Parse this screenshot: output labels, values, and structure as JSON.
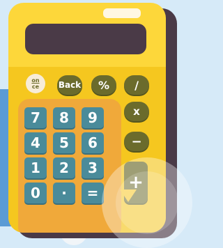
{
  "calculator": {
    "top_row": {
      "on_label": "on",
      "ce_label": "ce",
      "back_label": "Back",
      "percent_label": "%",
      "divide_label": "/"
    },
    "ops": {
      "multiply_label": "x",
      "minus_label": "−",
      "plus_label": "+"
    },
    "keypad": {
      "k7": "7",
      "k8": "8",
      "k9": "9",
      "k4": "4",
      "k5": "5",
      "k6": "6",
      "k1": "1",
      "k2": "2",
      "k3": "3",
      "k0": "0",
      "dot": "·",
      "equals": "="
    },
    "display_value": ""
  },
  "colors": {
    "body_yellow": "#fdd73a",
    "keypad_orange": "#f0a93a",
    "screen_dark": "#4a3a47",
    "op_olive": "#6b6b2c",
    "digit_teal": "#4a8b9a",
    "background_blue": "#5b9bd5"
  },
  "icons": [
    "plus-pointer-arrow"
  ]
}
